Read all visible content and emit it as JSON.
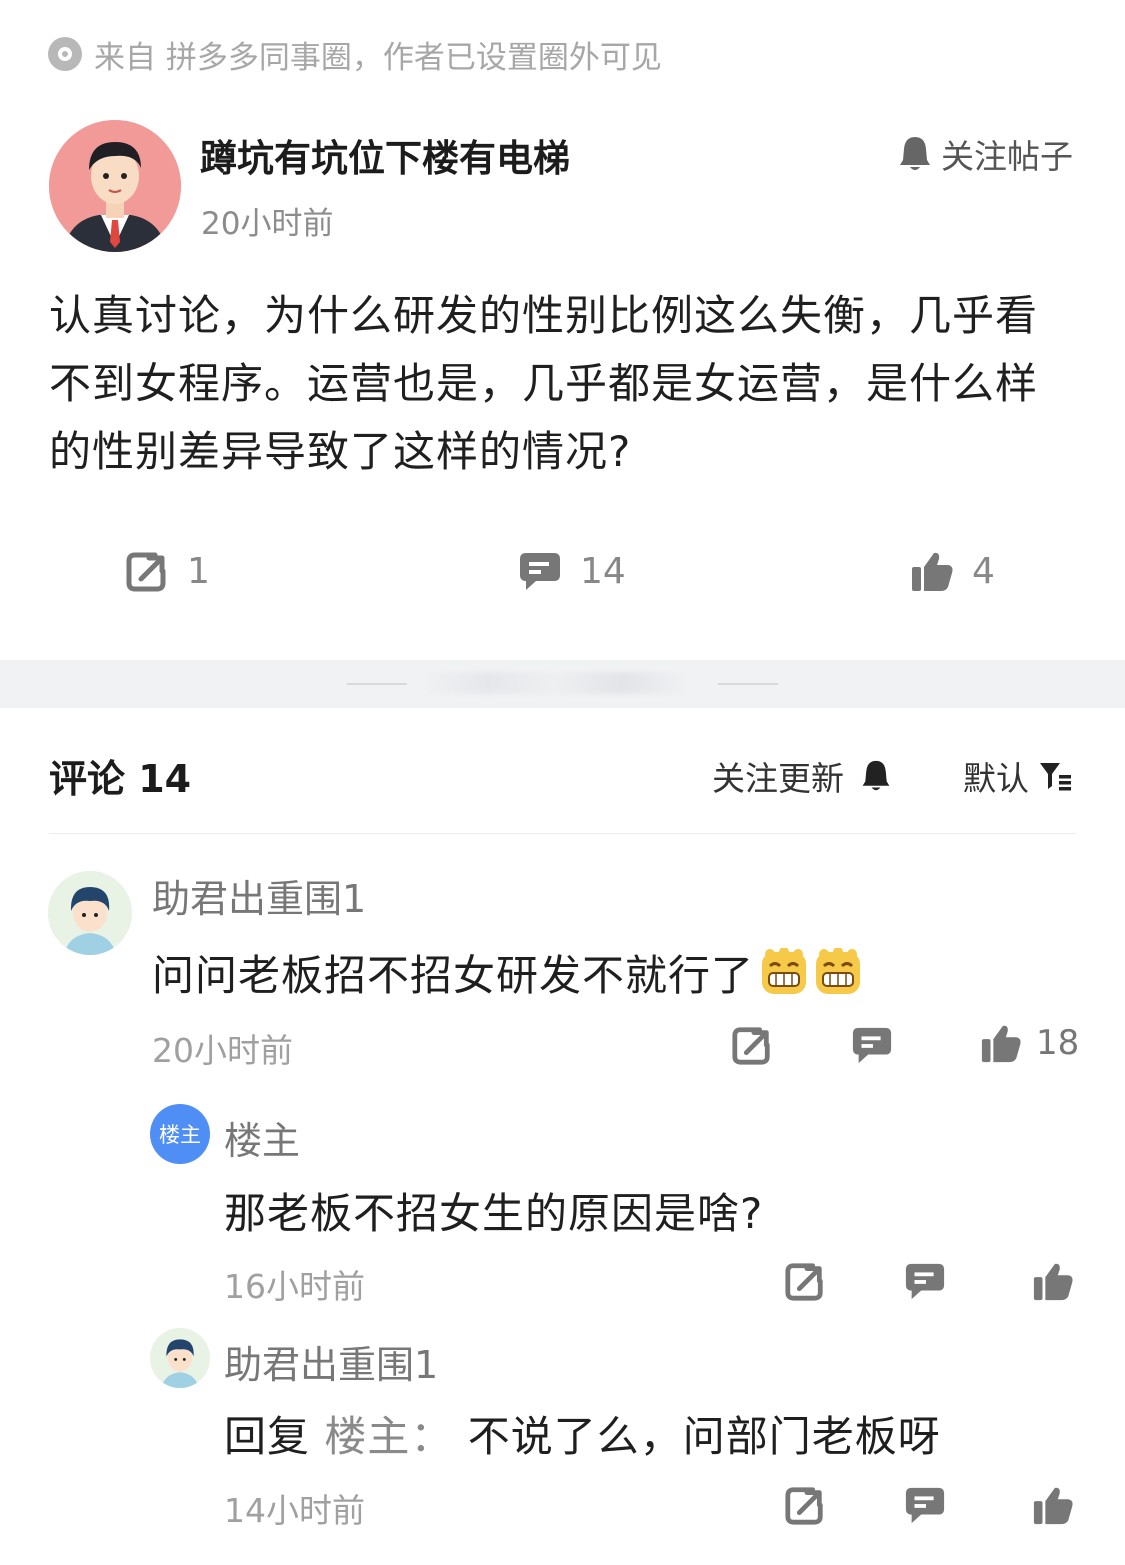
{
  "source": {
    "text": "来自 拼多多同事圈，作者已设置圈外可见"
  },
  "post": {
    "author": "蹲坑有坑位下楼有电梯",
    "time": "20小时前",
    "follow_label": "关注帖子",
    "body": "认真讨论，为什么研发的性别比例这么失衡，几乎看不到女程序。运营也是，几乎都是女运营，是什么样的性别差异导致了这样的情况?",
    "share_count": "1",
    "comment_count": "14",
    "like_count": "4"
  },
  "comments_header": {
    "title": "评论 14",
    "follow_update": "关注更新",
    "sort_label": "默认"
  },
  "comments": [
    {
      "name": "助君出重围1",
      "text": "问问老板招不招女研发不就行了",
      "time": "20小时前",
      "likes": "18"
    },
    {
      "badge": "楼主",
      "name": "楼主",
      "text": "那老板不招女生的原因是啥?",
      "time": "16小时前"
    },
    {
      "name": "助君出重围1",
      "reply_prefix": "回复",
      "reply_target": "楼主：",
      "text": "不说了么，问部门老板呀",
      "time": "14小时前"
    }
  ],
  "colors": {
    "accent_blue": "#4f8ef5",
    "icon_gray": "#7a7a7a",
    "separator": "#f1f2f4"
  }
}
